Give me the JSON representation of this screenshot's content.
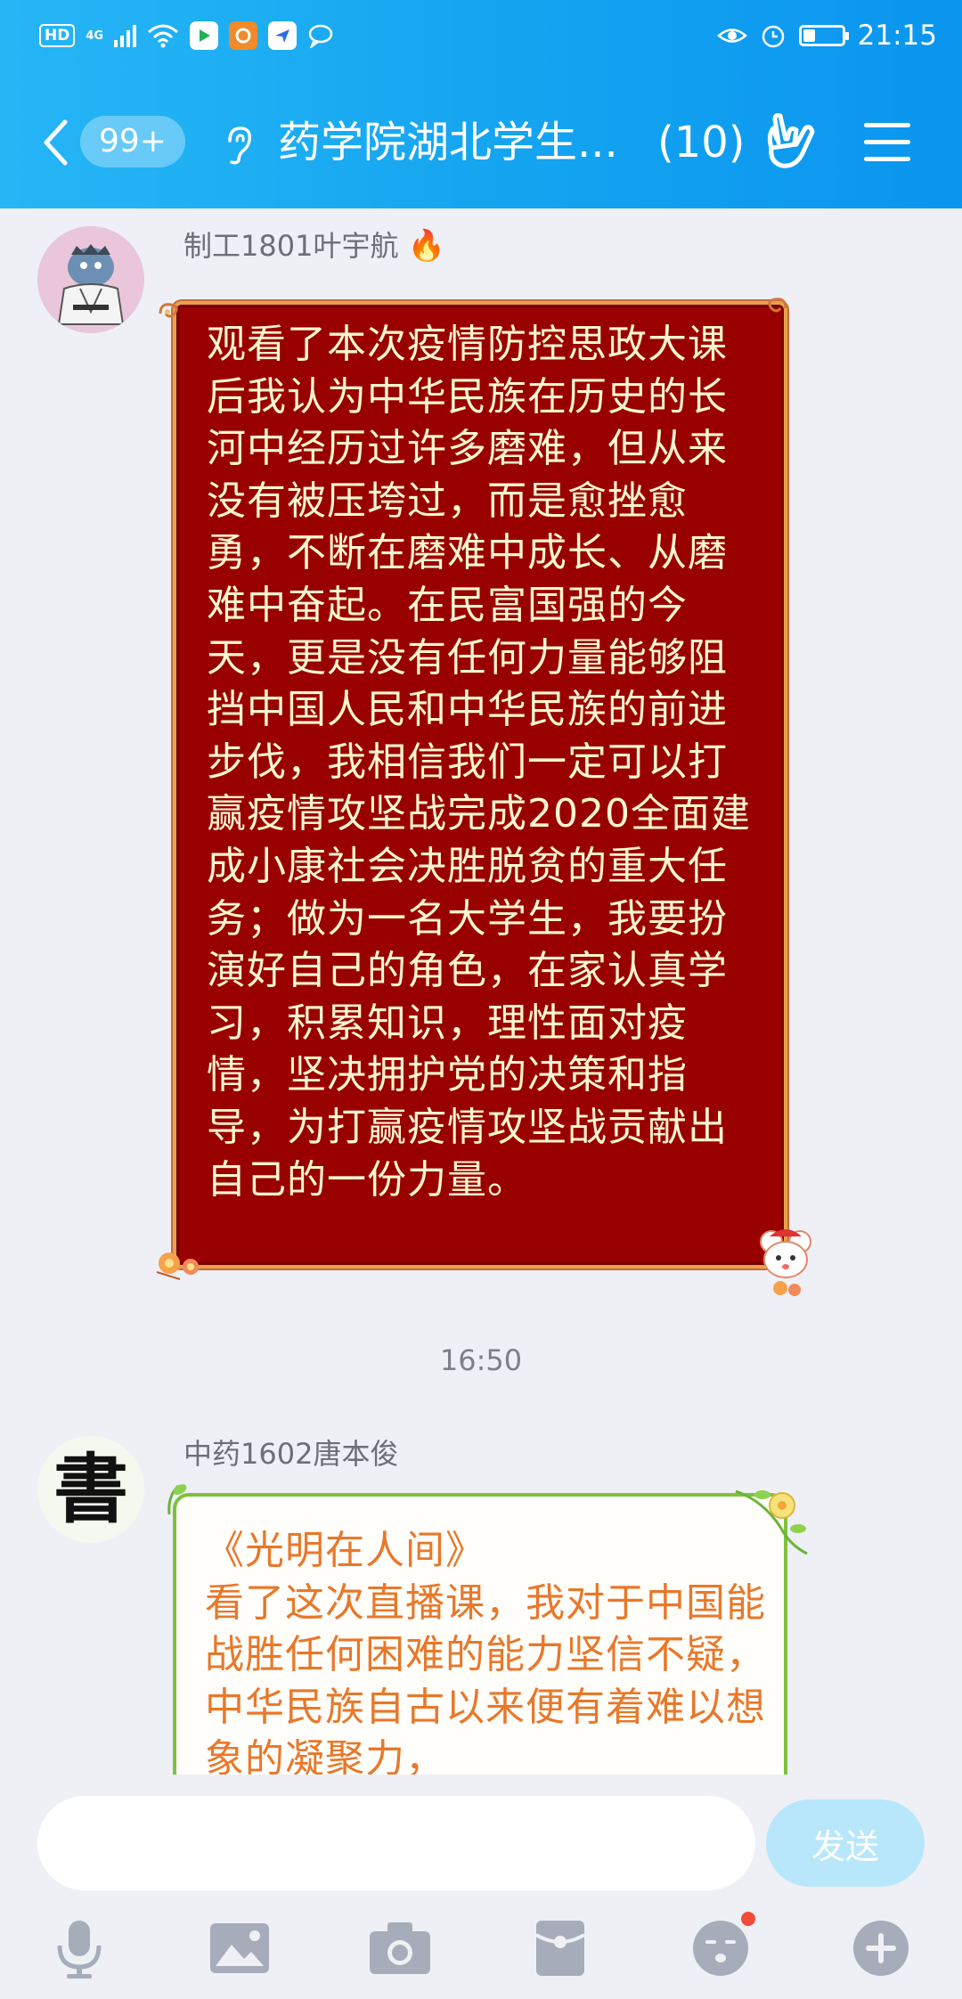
{
  "status_bar": {
    "hd": "HD",
    "network": "4G",
    "time": "21:15",
    "battery_level": 0.3
  },
  "nav": {
    "unread_badge": "99+",
    "title": "药学院湖北学生...",
    "member_count": "(10)"
  },
  "messages": [
    {
      "sender": "制工1801叶宇航",
      "text": "观看了本次疫情防控思政大课后我认为中华民族在历史的长河中经历过许多磨难，但从来没有被压垮过，而是愈挫愈勇，不断在磨难中成长、从磨难中奋起。在民富国强的今天，更是没有任何力量能够阻挡中国人民和中华民族的前进步伐，我相信我们一定可以打赢疫情攻坚战完成2020全面建成小康社会决胜脱贫的重大任务；做为一名大学生，我要扮演好自己的角色，在家认真学习，积累知识，理性面对疫情，坚决拥护党的决策和指导，为打赢疫情攻坚战贡献出自己的一份力量。"
    },
    {
      "sender": "中药1602唐本俊",
      "avatar_char": "書",
      "text": "《光明在人间》\n看了这次直播课，我对于中国能战胜任何困难的能力坚信不疑，中华民族自古以来便有着难以想象的凝聚力，"
    }
  ],
  "timestamp": "16:50",
  "input": {
    "placeholder": "",
    "send_label": "发送"
  },
  "colors": {
    "header_start": "#26b6f6",
    "header_end": "#0a95ef",
    "bubble1_bg": "#990000",
    "bubble1_text": "#fff6cf",
    "bubble2_text": "#e8782a",
    "bubble2_border": "#7ec13c"
  },
  "icons": [
    "voice-icon",
    "image-icon",
    "camera-icon",
    "red-packet-icon",
    "emoji-icon",
    "plus-icon"
  ]
}
